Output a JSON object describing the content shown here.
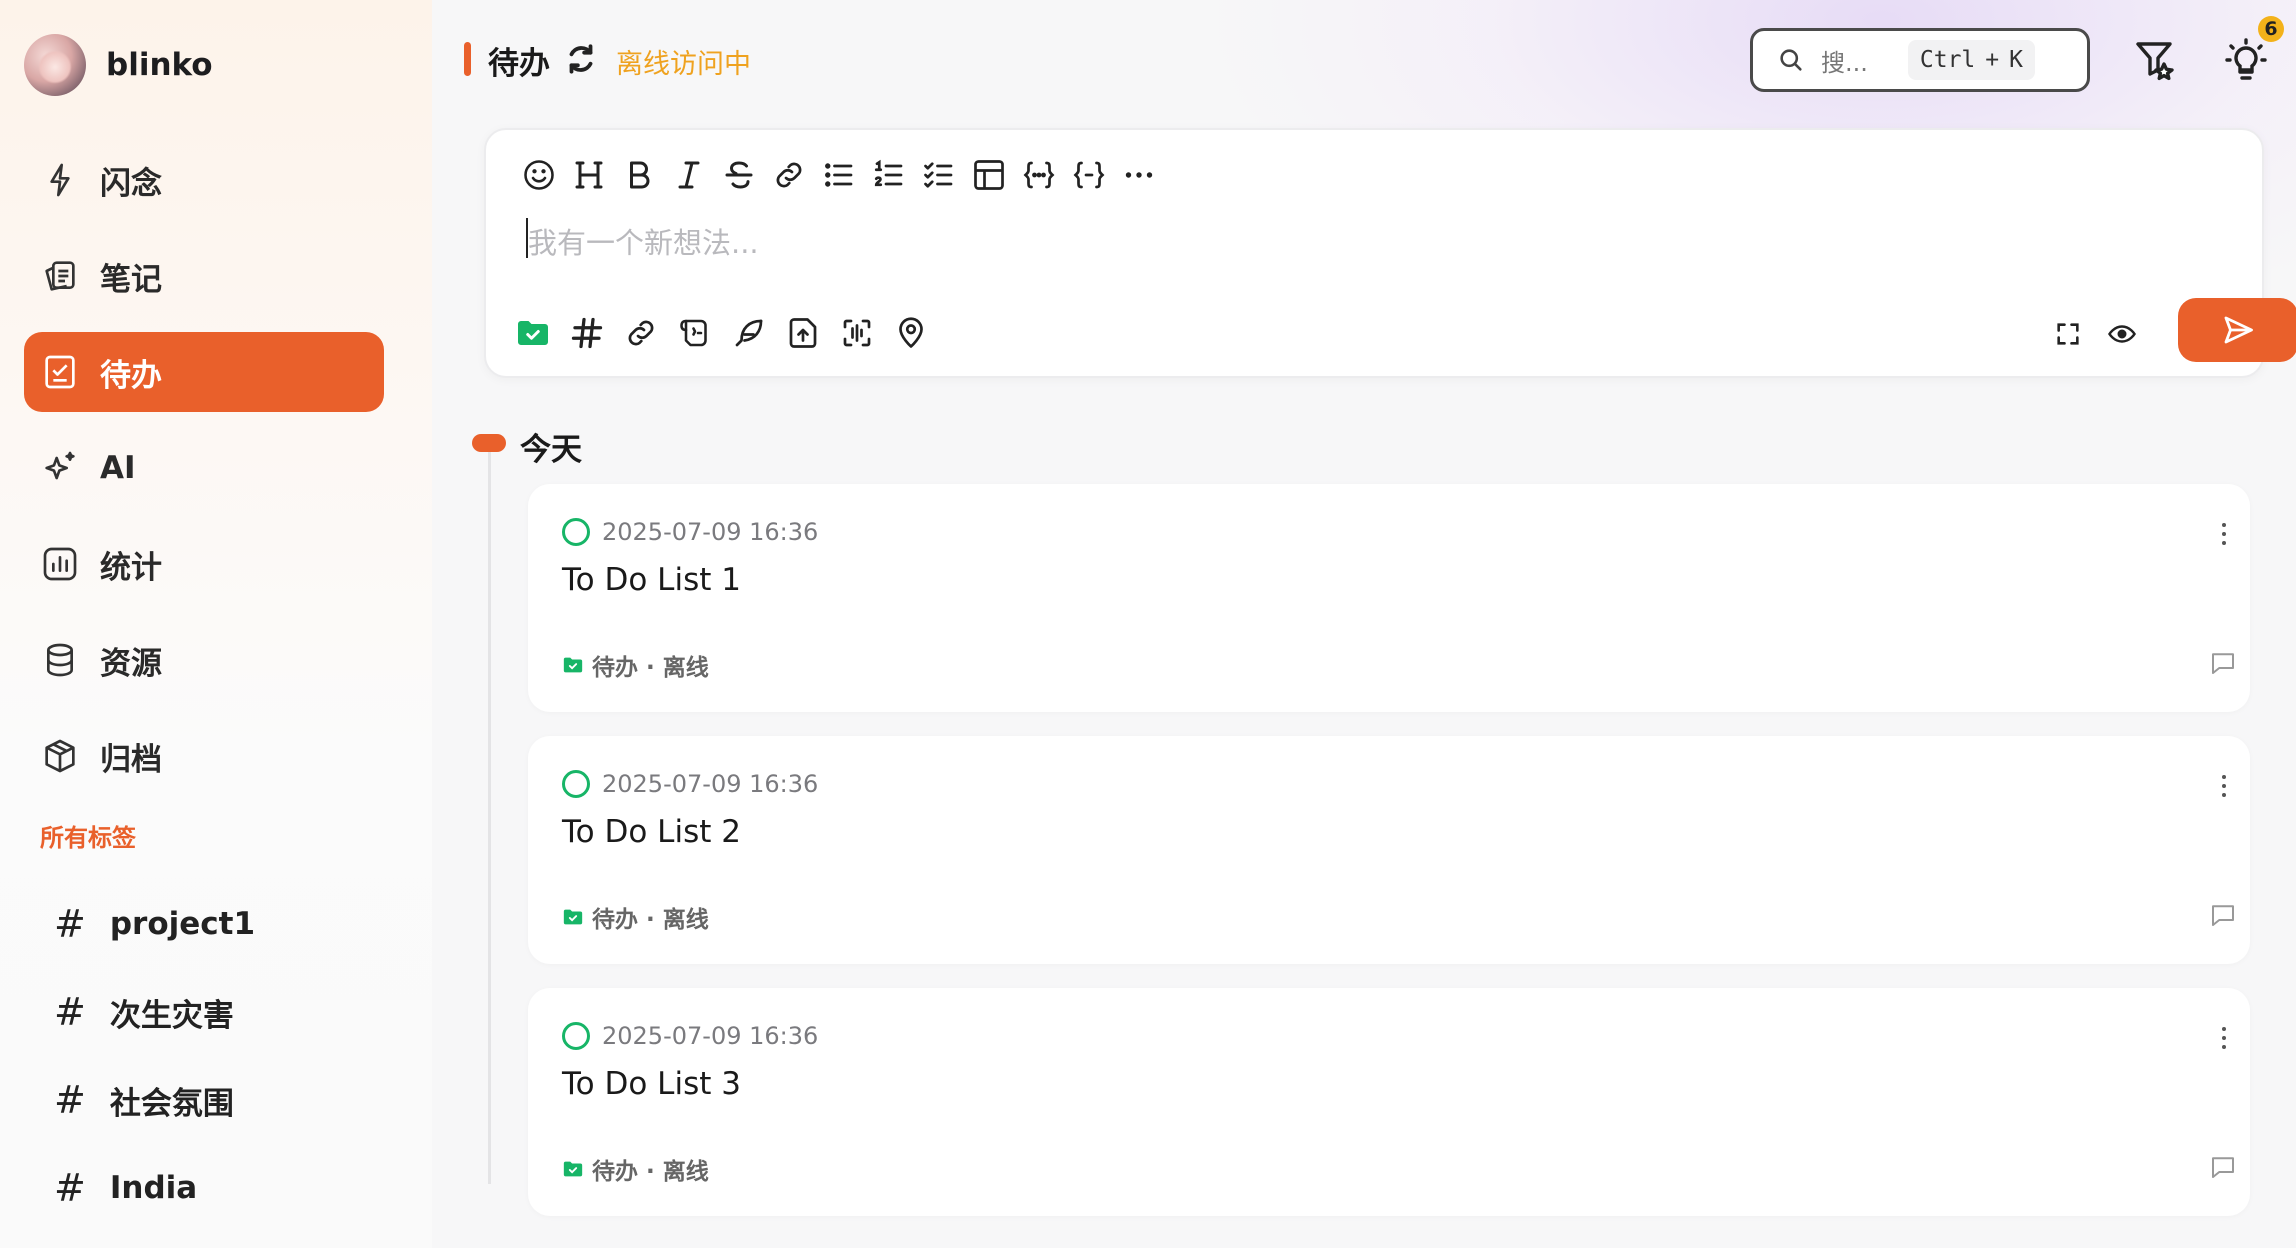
{
  "app": {
    "name": "blinko"
  },
  "sidebar": {
    "items": [
      {
        "label": "闪念",
        "icon": "bolt-icon",
        "active": false
      },
      {
        "label": "笔记",
        "icon": "notes-icon",
        "active": false
      },
      {
        "label": "待办",
        "icon": "todo-icon",
        "active": true
      },
      {
        "label": "AI",
        "icon": "sparkle-icon",
        "active": false
      },
      {
        "label": "统计",
        "icon": "chart-icon",
        "active": false
      },
      {
        "label": "资源",
        "icon": "database-icon",
        "active": false
      },
      {
        "label": "归档",
        "icon": "archive-box-icon",
        "active": false
      }
    ],
    "tags_title": "所有标签",
    "tags": [
      "project1",
      "次生灾害",
      "社会氛围",
      "India"
    ]
  },
  "header": {
    "title": "待办",
    "status": "离线访问中",
    "search_placeholder": "搜...",
    "shortcut_key1": "Ctrl",
    "shortcut_plus": "+",
    "shortcut_key2": "K",
    "notification_count": "6"
  },
  "editor": {
    "placeholder": "我有一个新想法..."
  },
  "timeline": {
    "group_label": "今天",
    "cards": [
      {
        "time": "2025-07-09 16:36",
        "title": "To Do List 1",
        "tag": "待办 · 离线"
      },
      {
        "time": "2025-07-09 16:36",
        "title": "To Do List 2",
        "tag": "待办 · 离线"
      },
      {
        "time": "2025-07-09 16:36",
        "title": "To Do List 3",
        "tag": "待办 · 离线"
      }
    ]
  },
  "colors": {
    "accent": "#e9602b",
    "offline": "#efa21f",
    "check": "#17b567",
    "badge": "#f3b21a"
  }
}
